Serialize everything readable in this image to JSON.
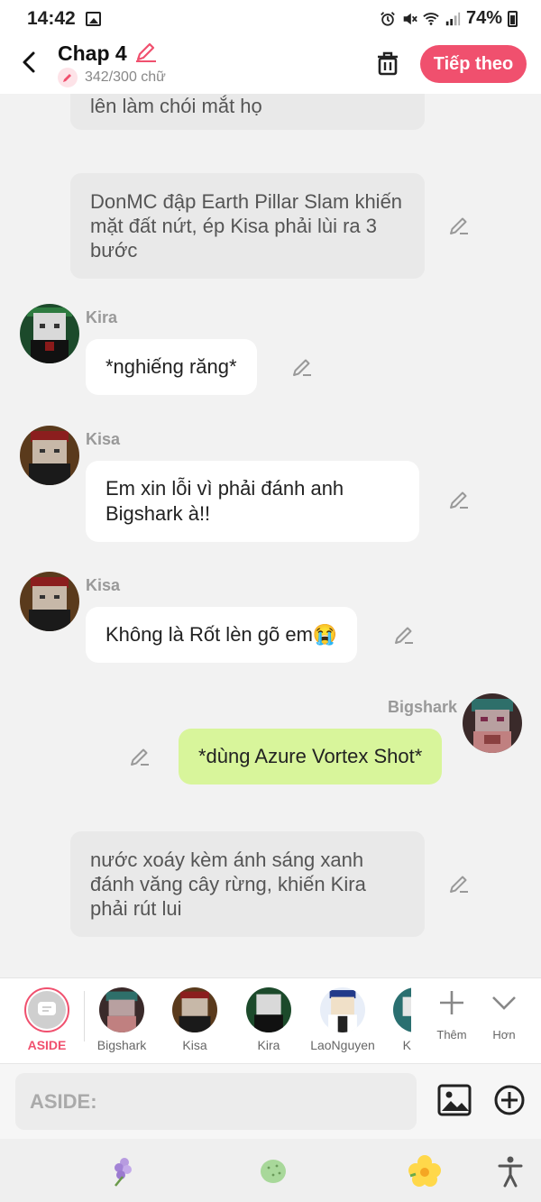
{
  "status_bar": {
    "time": "14:42",
    "battery": "74%"
  },
  "header": {
    "title": "Chap 4",
    "word_count": "342/300 chữ",
    "next_label": "Tiếp theo"
  },
  "messages": {
    "narr1": "lên làm chói mắt họ",
    "narr2": "DonMC đập Earth Pillar Slam khiến mặt đất nứt, ép Kisa phải lùi ra 3 bước",
    "m1_name": "Kira",
    "m1_text": "*nghiếng răng*",
    "m2_name": "Kisa",
    "m2_text": "Em xin lỗi vì phải đánh anh Bigshark à!!",
    "m3_name": "Kisa",
    "m3_text": "Không là Rốt lèn gõ em😭",
    "m4_name": "Bigshark",
    "m4_text": "*dùng Azure Vortex Shot*",
    "narr3": "nước xoáy kèm ánh sáng xanh đánh văng cây rừng, khiến Kira phải rút lui"
  },
  "characters": {
    "aside": "ASIDE",
    "c1": "Bigshark",
    "c2": "Kisa",
    "c3": "Kira",
    "c4": "LaoNguyen",
    "c5": "K",
    "more": "Thêm",
    "less": "Hơn"
  },
  "input": {
    "placeholder": "ASIDE:"
  },
  "colors": {
    "accent": "#f0506e",
    "my_bubble": "#d8f59b",
    "narration_bg": "#e9e9e9"
  }
}
